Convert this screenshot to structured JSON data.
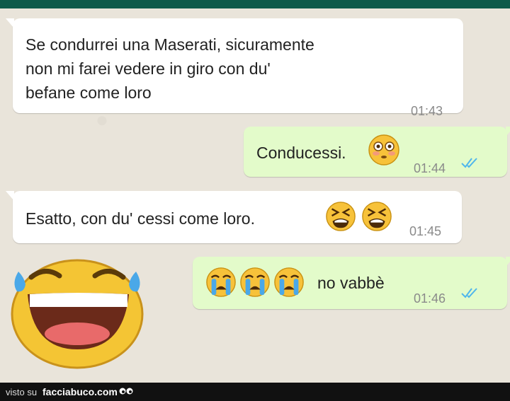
{
  "messages": [
    {
      "text_lines": [
        "Se condurrei una Maserati, sicuramente",
        "non mi farei vedere in giro con du'",
        "befane come loro"
      ],
      "time": "01:43"
    },
    {
      "text": "Conducessi.",
      "time": "01:44",
      "emoji": "flushed-face"
    },
    {
      "text": "Esatto, con du' cessi come loro.",
      "time": "01:45",
      "emoji": "tired-face"
    },
    {
      "text": "no vabbè",
      "time": "01:46",
      "emoji": "crying-face"
    }
  ],
  "footer": {
    "visto": "visto su",
    "site": "facciabuco.com"
  },
  "colors": {
    "incoming": "#ffffff",
    "outgoing": "#e3fbca",
    "ticks": "#4fb6ec",
    "header": "#0e5a4a"
  }
}
